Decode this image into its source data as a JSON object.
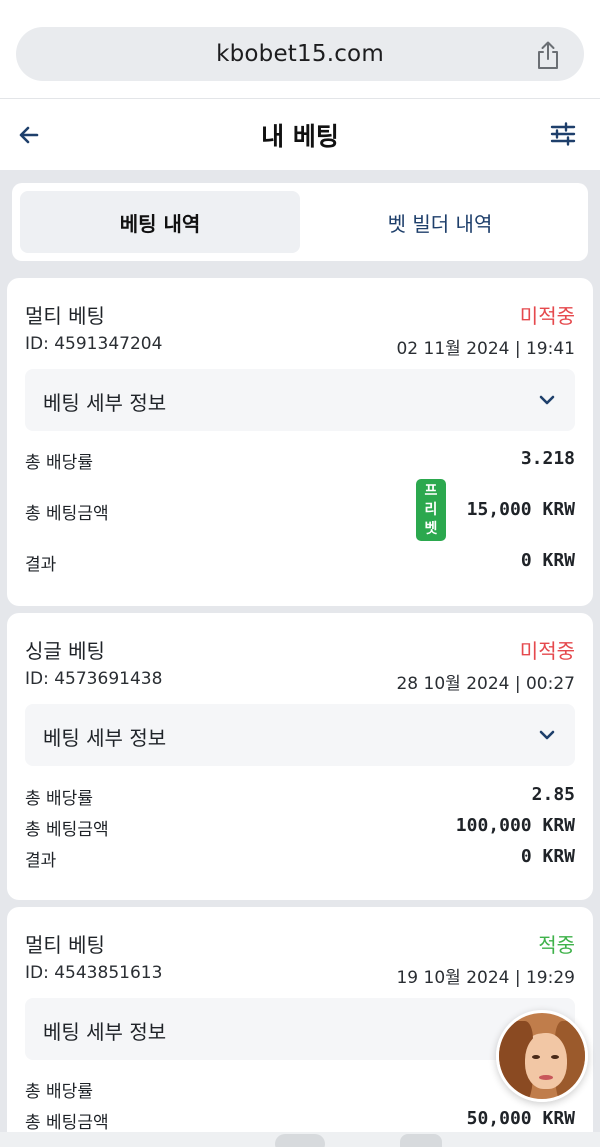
{
  "browser": {
    "url": "kbobet15.com",
    "share_icon": "share-icon"
  },
  "header": {
    "title": "내 베팅",
    "back_icon": "arrow-left-icon",
    "filter_icon": "sliders-icon"
  },
  "tabs": [
    {
      "label": "베팅 내역",
      "active": true
    },
    {
      "label": "벳 빌더 내역",
      "active": false
    }
  ],
  "bets": [
    {
      "type": "멀티 베팅",
      "status": "미적중",
      "status_color": "#e5494d",
      "id": "ID: 4591347204",
      "date": "02 11월 2024 | 19:41",
      "details_label": "베팅 세부 정보",
      "rows": [
        {
          "label": "총 배당률",
          "value": "3.218"
        },
        {
          "label": "총 베팅금액",
          "value": "15,000 KRW"
        },
        {
          "label": "결과",
          "value": "0 KRW"
        }
      ],
      "freebet_badge": [
        "프",
        "리",
        "벳"
      ]
    },
    {
      "type": "싱글 베팅",
      "status": "미적중",
      "status_color": "#e5494d",
      "id": "ID: 4573691438",
      "date": "28 10월 2024 | 00:27",
      "details_label": "베팅 세부 정보",
      "rows": [
        {
          "label": "총 배당률",
          "value": "2.85"
        },
        {
          "label": "총 베팅금액",
          "value": "100,000 KRW"
        },
        {
          "label": "결과",
          "value": "0 KRW"
        }
      ]
    },
    {
      "type": "멀티 베팅",
      "status": "적중",
      "status_color": "#3fb24a",
      "id": "ID: 4543851613",
      "date": "19 10월 2024 | 19:29",
      "details_label": "베팅 세부 정보",
      "rows": [
        {
          "label": "총 배당률",
          "value": ""
        },
        {
          "label": "총 베팅금액",
          "value": "50,000 KRW"
        }
      ]
    }
  ]
}
